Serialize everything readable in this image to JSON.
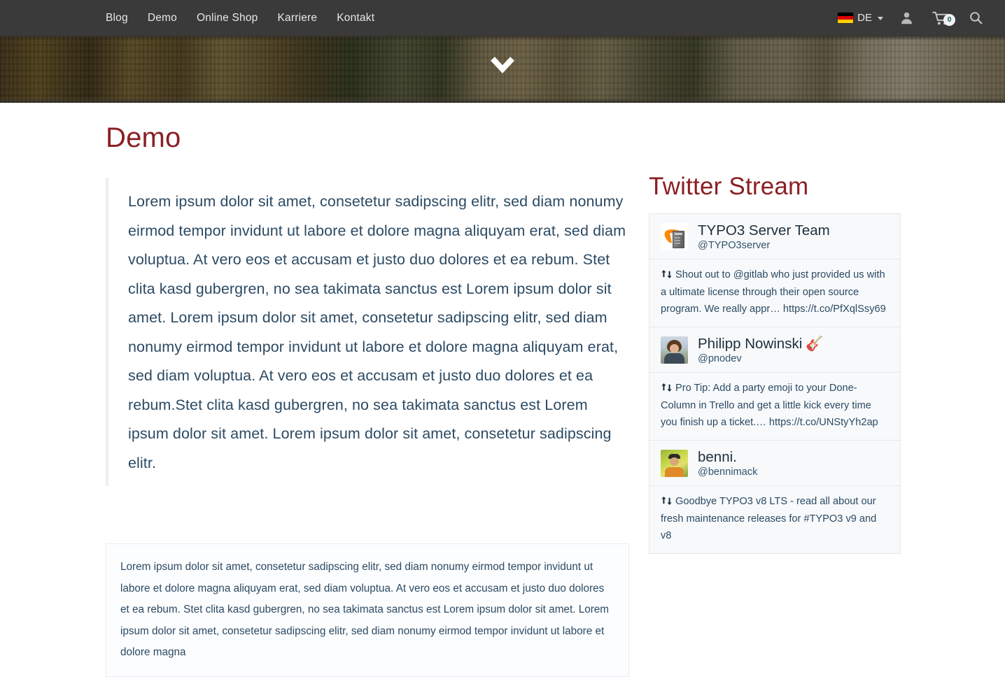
{
  "header": {
    "nav": [
      {
        "label": "Blog"
      },
      {
        "label": "Demo"
      },
      {
        "label": "Online Shop"
      },
      {
        "label": "Karriere"
      },
      {
        "label": "Kontakt"
      }
    ],
    "language": {
      "code": "DE",
      "flag_icon": "german-flag-icon",
      "caret_icon": "chevron-down-icon"
    },
    "account_icon": "user-icon",
    "cart_icon": "shopping-cart-icon",
    "cart_count": "0",
    "search_icon": "search-icon",
    "background_color": "#3a3a3a"
  },
  "hero": {
    "scroll_icon": "chevron-down-icon"
  },
  "main": {
    "page_title": "Demo",
    "title_color": "#8b1f24",
    "lead_text": "Lorem ipsum dolor sit amet, consetetur sadipscing elitr, sed diam nonumy eirmod tempor invidunt ut labore et dolore magna aliquyam erat, sed diam voluptua. At vero eos et accusam et justo duo dolores et ea rebum. Stet clita kasd gubergren, no sea takimata sanctus est Lorem ipsum dolor sit amet. Lorem ipsum dolor sit amet, consetetur sadipscing elitr, sed diam nonumy eirmod tempor invidunt ut labore et dolore magna aliquyam erat, sed diam voluptua. At vero eos et accusam et justo duo dolores et ea rebum.Stet clita kasd gubergren, no sea takimata sanctus est Lorem ipsum dolor sit amet. Lorem ipsum dolor sit amet, consetetur sadipscing elitr.",
    "body_text": "Lorem ipsum dolor sit amet, consetetur sadipscing elitr, sed diam nonumy eirmod tempor invidunt ut labore et dolore magna aliquyam erat, sed diam voluptua. At vero eos et accusam et justo duo dolores et ea rebum. Stet clita kasd gubergren, no sea takimata sanctus est Lorem ipsum dolor sit amet. Lorem ipsum dolor sit amet, consetetur sadipscing elitr, sed diam nonumy eirmod tempor invidunt ut labore et dolore magna",
    "text_color": "#2c4a63"
  },
  "twitter": {
    "heading": "Twitter Stream",
    "tweets": [
      {
        "name": "TYPO3 Server Team",
        "handle": "@TYPO3server",
        "avatar_icon": "typo3-server-avatar",
        "retweet_icon": "retweet-icon",
        "text": "Shout out to @gitlab who just provided us with a ultimate license through their open source program. We really appr… https://t.co/PfXqlSsy69"
      },
      {
        "name": "Philipp Nowinski",
        "name_emoji": "🎸",
        "handle": "@pnodev",
        "avatar_icon": "philipp-nowinski-avatar",
        "retweet_icon": "retweet-icon",
        "text": "Pro Tip: Add a party emoji to your Done-Column in Trello and get a little kick every time you finish up a ticket.… https://t.co/UNStyYh2ap"
      },
      {
        "name": "benni.",
        "handle": "@bennimack",
        "avatar_icon": "benni-avatar",
        "retweet_icon": "retweet-icon",
        "text": "Goodbye TYPO3 v8 LTS - read all about our fresh maintenance releases for #TYPO3 v9 and v8"
      }
    ]
  }
}
